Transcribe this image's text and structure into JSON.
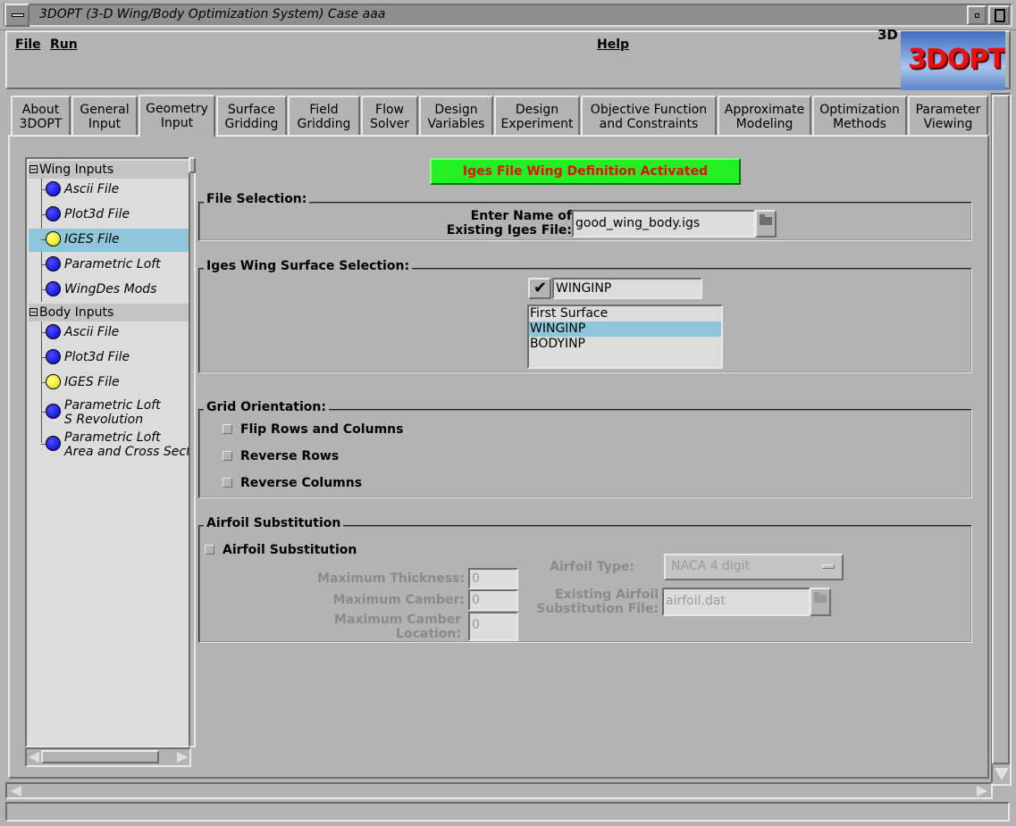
{
  "window": {
    "title": "3DOPT (3-D Wing/Body Optimization System) Case aaa"
  },
  "menubar": {
    "file": "File",
    "run": "Run",
    "help": "Help",
    "logo_prefix": "3D",
    "logo": "3DOPT"
  },
  "tabs": [
    {
      "line1": "About",
      "line2": "3DOPT"
    },
    {
      "line1": "General",
      "line2": "Input"
    },
    {
      "line1": "Geometry",
      "line2": "Input"
    },
    {
      "line1": "Surface",
      "line2": "Gridding"
    },
    {
      "line1": "Field",
      "line2": "Gridding"
    },
    {
      "line1": "Flow",
      "line2": "Solver"
    },
    {
      "line1": "Design",
      "line2": "Variables"
    },
    {
      "line1": "Design",
      "line2": "Experiment"
    },
    {
      "line1": "Objective Function",
      "line2": "and Constraints"
    },
    {
      "line1": "Approximate",
      "line2": "Modeling"
    },
    {
      "line1": "Optimization",
      "line2": "Methods"
    },
    {
      "line1": "Parameter",
      "line2": "Viewing"
    }
  ],
  "tree": {
    "wing_header": "Wing Inputs",
    "wing_items": [
      "Ascii File",
      "Plot3d File",
      "IGES File",
      "Parametric Loft",
      "WingDes Mods"
    ],
    "body_header": "Body Inputs",
    "body_items": [
      "Ascii File",
      "Plot3d File",
      "IGES File"
    ],
    "body_loft_s": {
      "line1": "Parametric Loft",
      "line2": "S Revolution"
    },
    "body_loft_area": {
      "line1": "Parametric Loft",
      "line2": "Area and Cross Sect"
    }
  },
  "banner": "Iges File Wing Definition Activated",
  "file_selection": {
    "title": "File Selection:",
    "label_line1": "Enter Name of",
    "label_line2": "Existing Iges File:",
    "value": "good_wing_body.igs"
  },
  "surface_selection": {
    "title": "Iges Wing Surface Selection:",
    "current": "WINGINP",
    "options": [
      "First Surface",
      "WINGINP",
      "BODYINP"
    ],
    "selected_index": 1
  },
  "grid_orientation": {
    "title": "Grid Orientation:",
    "options": [
      "Flip Rows and Columns",
      "Reverse Rows",
      "Reverse Columns"
    ]
  },
  "airfoil": {
    "title": "Airfoil Substitution",
    "checkbox": "Airfoil Substitution",
    "max_thickness_label": "Maximum Thickness:",
    "max_thickness_value": "0",
    "max_camber_label": "Maximum Camber:",
    "max_camber_value": "0",
    "max_camber_loc_line1": "Maximum Camber",
    "max_camber_loc_line2": "Location:",
    "max_camber_loc_value": "0",
    "type_label": "Airfoil Type:",
    "type_value": "NACA 4 digit",
    "file_label_line1": "Existing Airfoil",
    "file_label_line2": "Substitution File:",
    "file_value": "airfoil.dat"
  }
}
